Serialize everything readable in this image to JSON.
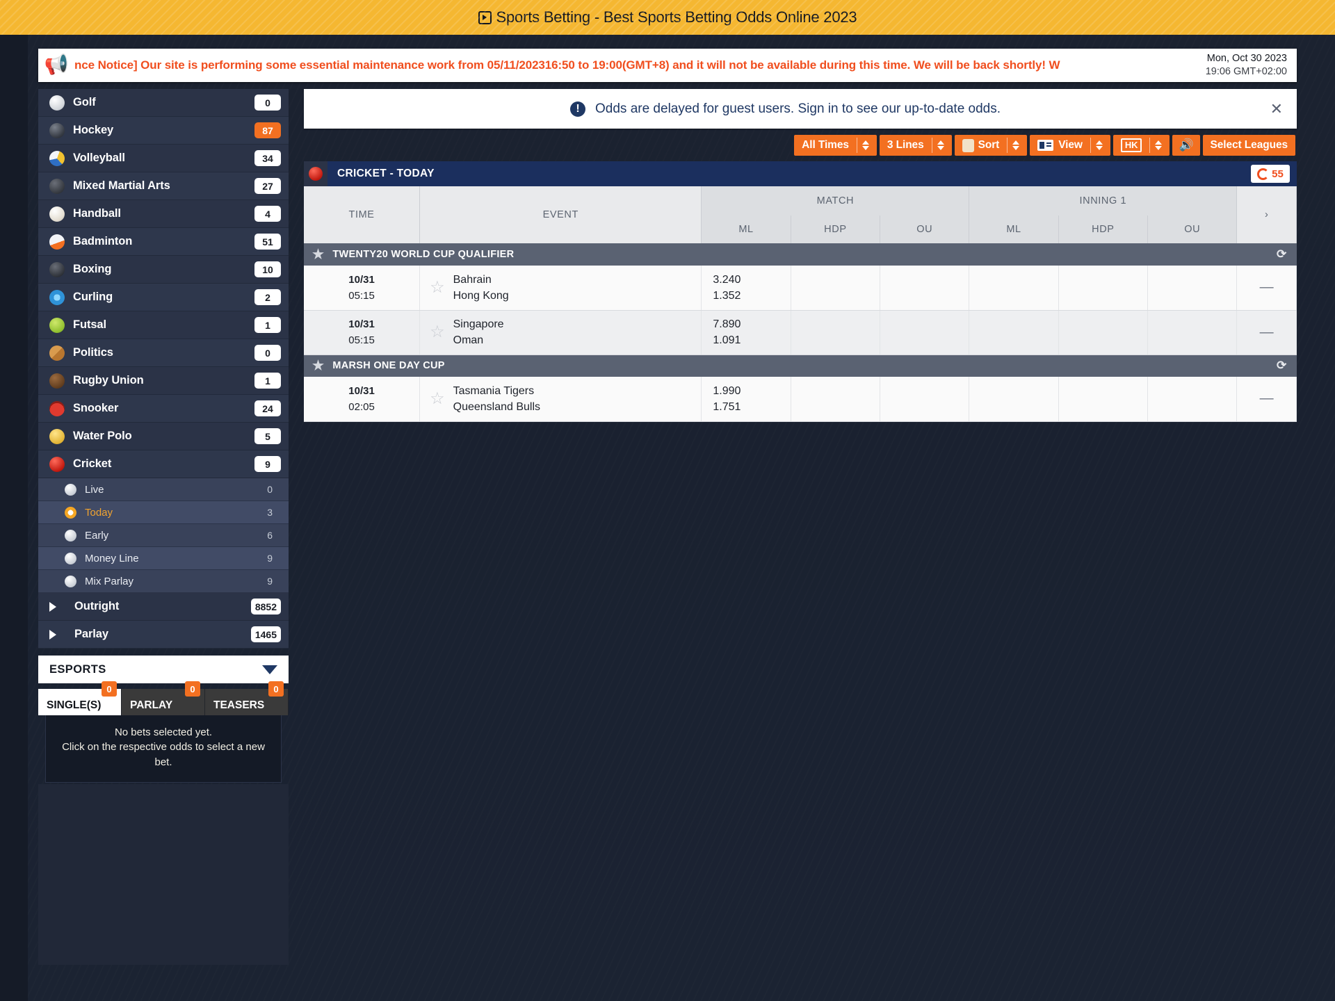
{
  "browser": {
    "tab_title": "Sports Betting - Best Sports Betting Odds Online 2023",
    "tab_icon": "video-tab-icon"
  },
  "notice": {
    "icon": "megaphone-icon",
    "text": "nce Notice] Our site is performing some essential maintenance work from 05/11/202316:50 to 19:00(GMT+8) and it will not be available during this time. We will be back shortly! W",
    "date": "Mon, Oct 30 2023",
    "time": "19:06 GMT+02:00"
  },
  "sidebar": {
    "sports": [
      {
        "label": "Golf",
        "count": "0",
        "icon": "golf-ball-icon",
        "cls": "ic-golf",
        "hot": false
      },
      {
        "label": "Hockey",
        "count": "87",
        "icon": "hockey-puck-icon",
        "cls": "ic-hockey",
        "hot": true
      },
      {
        "label": "Volleyball",
        "count": "34",
        "icon": "volleyball-icon",
        "cls": "ic-volleyball",
        "hot": false
      },
      {
        "label": "Mixed Martial Arts",
        "count": "27",
        "icon": "mma-glove-icon",
        "cls": "ic-mma",
        "hot": false
      },
      {
        "label": "Handball",
        "count": "4",
        "icon": "handball-icon",
        "cls": "ic-handball",
        "hot": false
      },
      {
        "label": "Badminton",
        "count": "51",
        "icon": "shuttlecock-icon",
        "cls": "ic-badminton",
        "hot": false
      },
      {
        "label": "Boxing",
        "count": "10",
        "icon": "boxing-glove-icon",
        "cls": "ic-boxing",
        "hot": false
      },
      {
        "label": "Curling",
        "count": "2",
        "icon": "curling-icon",
        "cls": "ic-curling",
        "hot": false
      },
      {
        "label": "Futsal",
        "count": "1",
        "icon": "futsal-ball-icon",
        "cls": "ic-futsal",
        "hot": false
      },
      {
        "label": "Politics",
        "count": "0",
        "icon": "politics-box-icon",
        "cls": "ic-politics",
        "hot": false
      },
      {
        "label": "Rugby Union",
        "count": "1",
        "icon": "rugby-ball-icon",
        "cls": "ic-rugby",
        "hot": false
      },
      {
        "label": "Snooker",
        "count": "24",
        "icon": "snooker-rack-icon",
        "cls": "ic-snooker",
        "hot": false
      },
      {
        "label": "Water Polo",
        "count": "5",
        "icon": "water-polo-icon",
        "cls": "ic-waterpolo",
        "hot": false
      },
      {
        "label": "Cricket",
        "count": "9",
        "icon": "cricket-ball-icon",
        "cls": "ic-cricket",
        "hot": false
      }
    ],
    "cricket_subitems": [
      {
        "label": "Live",
        "count": "0",
        "active": false
      },
      {
        "label": "Today",
        "count": "3",
        "active": true
      },
      {
        "label": "Early",
        "count": "6",
        "active": false
      },
      {
        "label": "Money Line",
        "count": "9",
        "active": false
      },
      {
        "label": "Mix Parlay",
        "count": "9",
        "active": false
      }
    ],
    "expandables": [
      {
        "label": "Outright",
        "count": "8852"
      },
      {
        "label": "Parlay",
        "count": "1465"
      }
    ],
    "esports": {
      "label": "ESPORTS",
      "chevron_icon": "chevron-down-icon"
    }
  },
  "betslip": {
    "tabs": [
      {
        "label": "SINGLE(S)",
        "count": "0",
        "active": true
      },
      {
        "label": "PARLAY",
        "count": "0",
        "active": false
      },
      {
        "label": "TEASERS",
        "count": "0",
        "active": false
      }
    ],
    "empty_line1": "No bets selected yet.",
    "empty_line2": "Click on the respective odds to select a new bet."
  },
  "guest_notice": {
    "icon": "info-icon",
    "text": "Odds are delayed for guest users. Sign in to see our up-to-date odds.",
    "close_icon": "close-icon"
  },
  "toolbar": {
    "buttons": [
      {
        "label": "All Times",
        "name": "all-times-filter",
        "spinner": true,
        "icon": null
      },
      {
        "label": "3 Lines",
        "name": "lines-filter",
        "spinner": true,
        "icon": null
      },
      {
        "label": "Sort",
        "name": "sort-filter",
        "spinner": true,
        "icon": "sort-icon"
      },
      {
        "label": "View",
        "name": "view-filter",
        "spinner": true,
        "icon": "view-icon"
      },
      {
        "label": "HK",
        "name": "odds-format",
        "spinner": true,
        "icon": "hk-icon"
      }
    ],
    "sound_icon": "speaker-icon",
    "select_leagues": "Select Leagues"
  },
  "sport_header": {
    "title": "CRICKET - TODAY",
    "icon": "cricket-ball-icon",
    "refresh_icon": "refresh-icon",
    "refresh_count": "55"
  },
  "table": {
    "headers": {
      "time": "TIME",
      "event": "EVENT",
      "groups": [
        {
          "label": "MATCH",
          "cols": [
            "ML",
            "HDP",
            "OU"
          ]
        },
        {
          "label": "INNING 1",
          "cols": [
            "ML",
            "HDP",
            "OU"
          ]
        }
      ],
      "arrow_icon": "chevron-right-icon"
    },
    "leagues": [
      {
        "name": "TWENTY20 WORLD CUP QUALIFIER",
        "star_icon": "star-icon",
        "refresh_icon": "refresh-icon",
        "matches": [
          {
            "date": "10/31",
            "time": "05:15",
            "star_icon": "star-outline-icon",
            "home": "Bahrain",
            "away": "Hong Kong",
            "ml_home": "3.240",
            "ml_away": "1.352",
            "hdp": "",
            "ou": "",
            "inning_ml": "",
            "inning_hdp": "",
            "inning_ou": "",
            "more": "—"
          },
          {
            "date": "10/31",
            "time": "05:15",
            "star_icon": "star-outline-icon",
            "home": "Singapore",
            "away": "Oman",
            "ml_home": "7.890",
            "ml_away": "1.091",
            "hdp": "",
            "ou": "",
            "inning_ml": "",
            "inning_hdp": "",
            "inning_ou": "",
            "more": "—"
          }
        ]
      },
      {
        "name": "MARSH ONE DAY CUP",
        "star_icon": "star-icon",
        "refresh_icon": "refresh-icon",
        "matches": [
          {
            "date": "10/31",
            "time": "02:05",
            "star_icon": "star-outline-icon",
            "home": "Tasmania Tigers",
            "away": "Queensland Bulls",
            "ml_home": "1.990",
            "ml_away": "1.751",
            "hdp": "",
            "ou": "",
            "inning_ml": "",
            "inning_hdp": "",
            "inning_ou": "",
            "more": "—"
          }
        ]
      }
    ]
  },
  "colors": {
    "accent_orange": "#f37021",
    "title_yellow": "#f5b731",
    "notice_red": "#f04e1e",
    "navy": "#1b2f5e",
    "page_bg": "#1b2230"
  }
}
